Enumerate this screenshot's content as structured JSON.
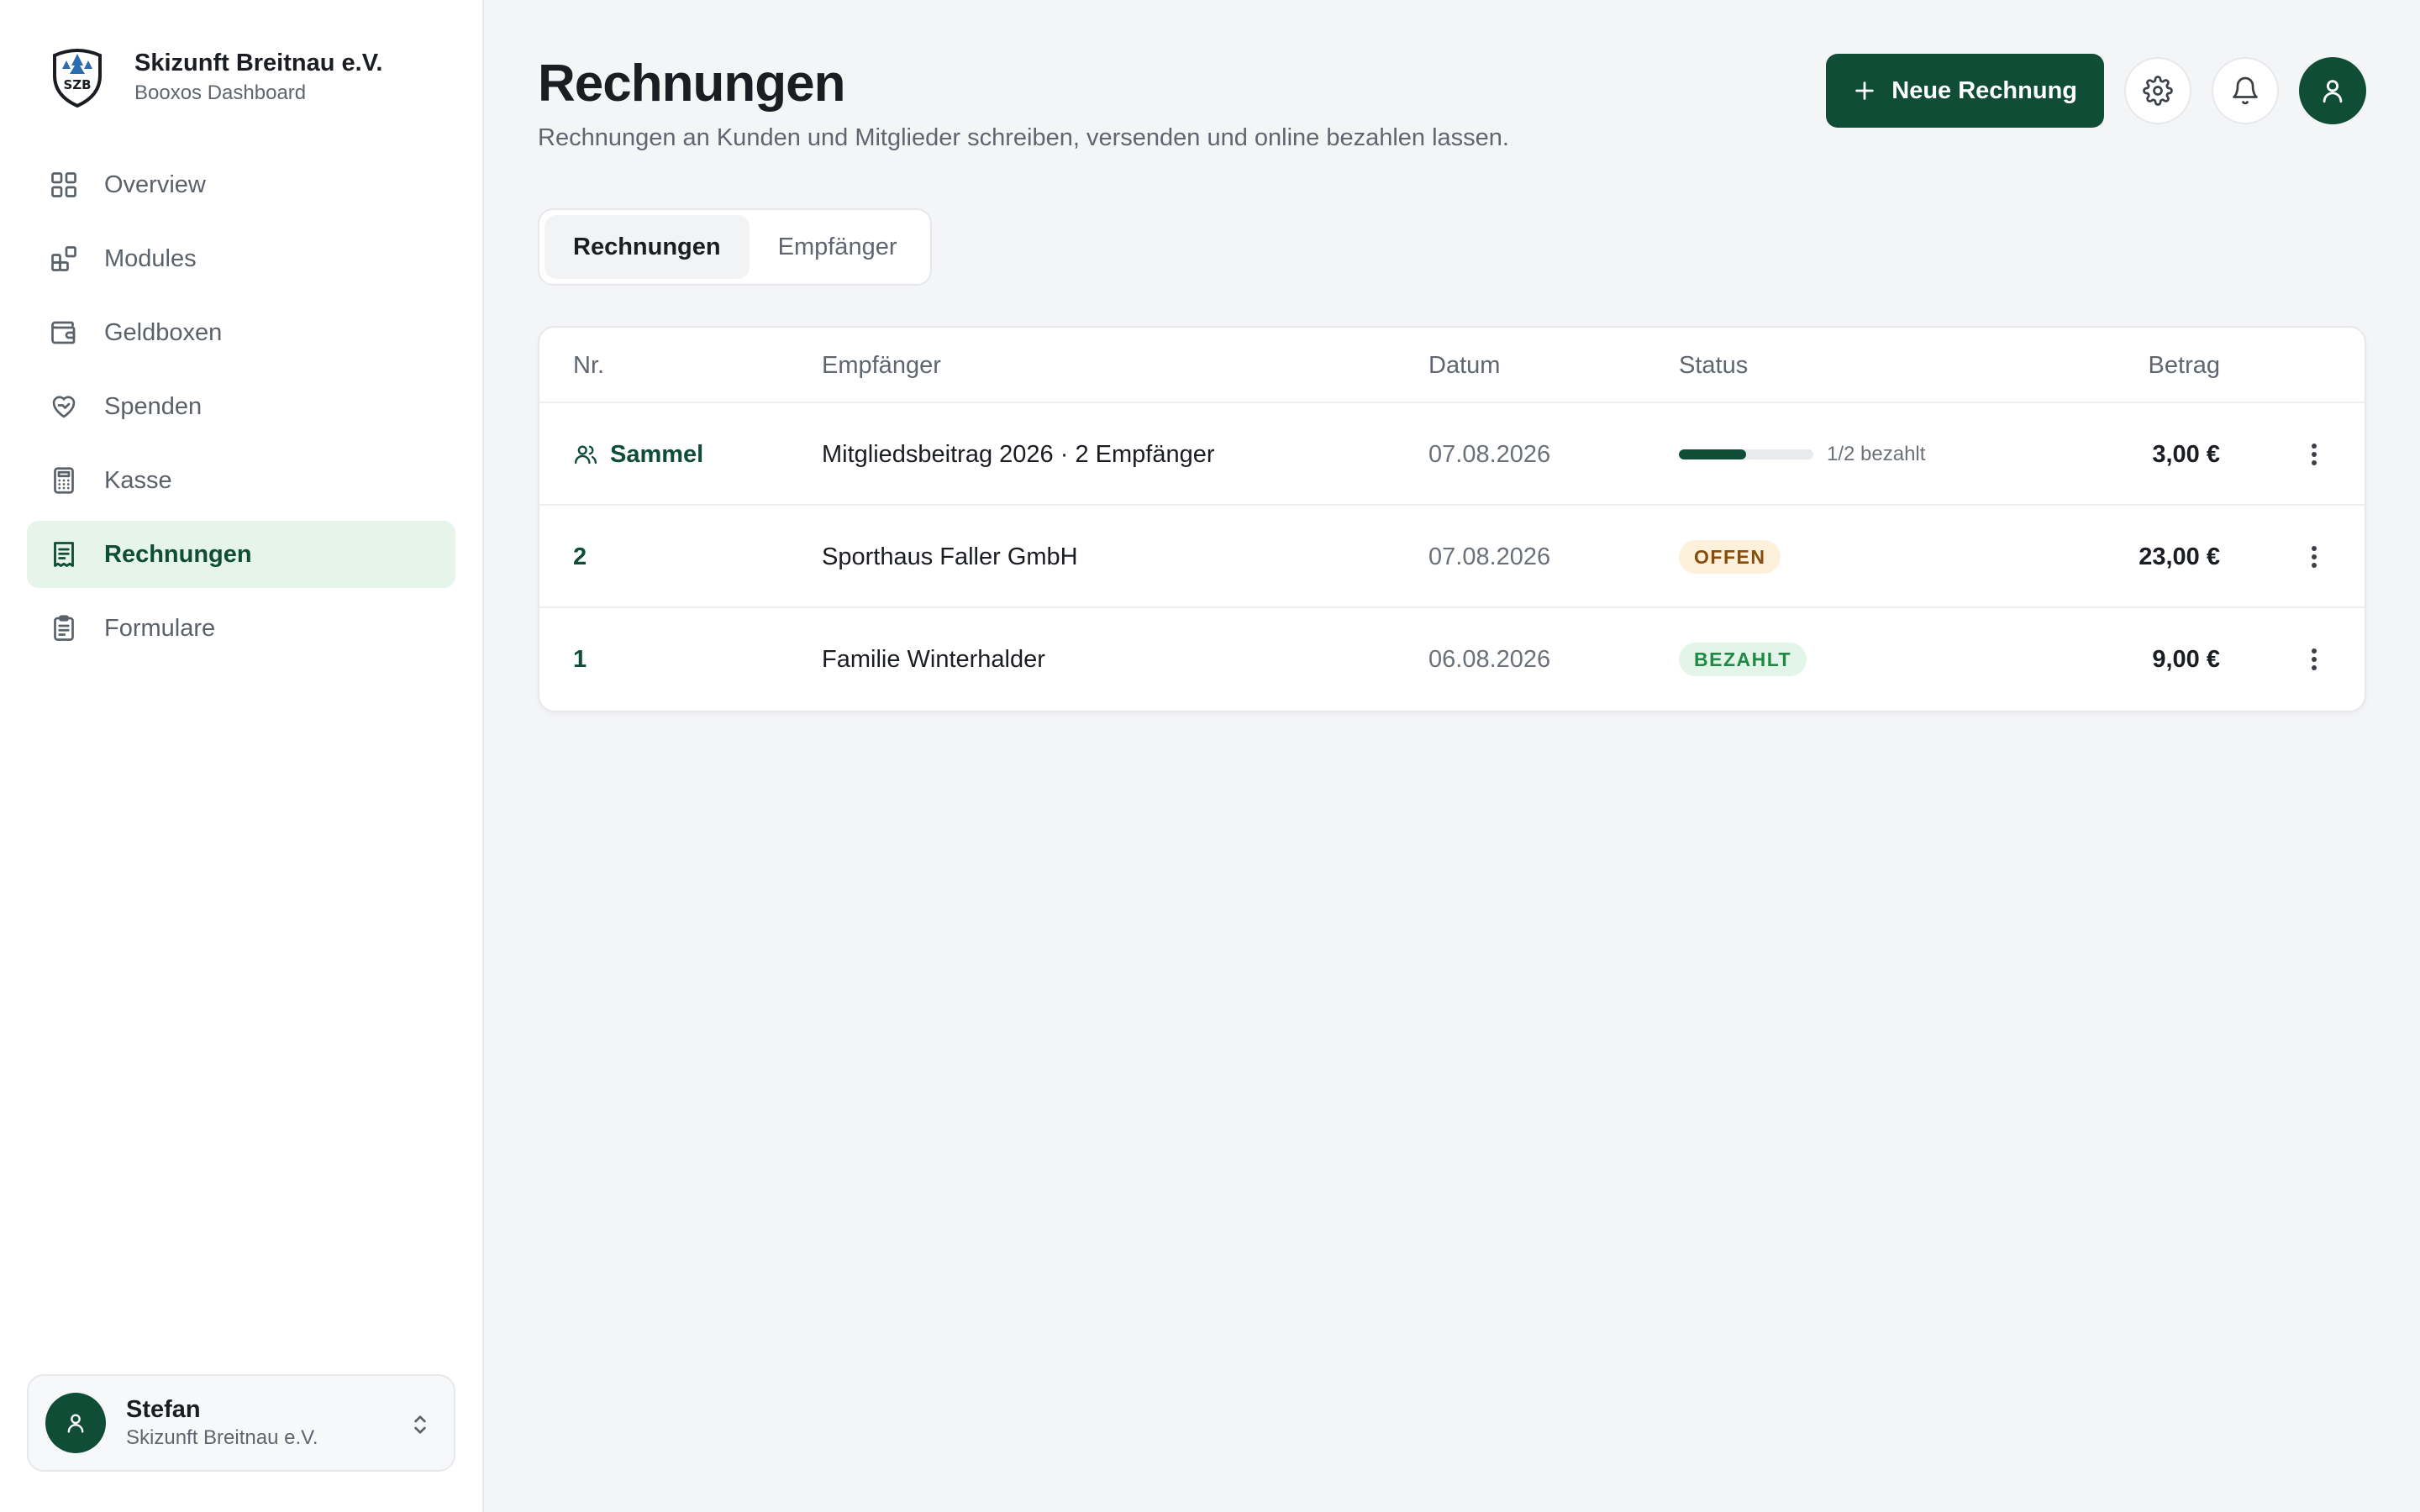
{
  "brand": {
    "name": "Skizunft Breitnau e.V.",
    "subtitle": "Booxos Dashboard",
    "logo_text": "SZB"
  },
  "sidebar": {
    "items": [
      {
        "label": "Overview",
        "icon": "grid-icon",
        "active": false
      },
      {
        "label": "Modules",
        "icon": "modules-icon",
        "active": false
      },
      {
        "label": "Geldboxen",
        "icon": "wallet-icon",
        "active": false
      },
      {
        "label": "Spenden",
        "icon": "heart-hand-icon",
        "active": false
      },
      {
        "label": "Kasse",
        "icon": "calculator-icon",
        "active": false
      },
      {
        "label": "Rechnungen",
        "icon": "receipt-icon",
        "active": true
      },
      {
        "label": "Formulare",
        "icon": "clipboard-icon",
        "active": false
      }
    ]
  },
  "user": {
    "name": "Stefan",
    "org": "Skizunft Breitnau e.V."
  },
  "header": {
    "title": "Rechnungen",
    "subtitle": "Rechnungen an Kunden und Mitglieder schreiben, versenden und online bezahlen lassen.",
    "new_button": "Neue Rechnung"
  },
  "tabs": [
    {
      "label": "Rechnungen",
      "active": true
    },
    {
      "label": "Empfänger",
      "active": false
    }
  ],
  "table": {
    "columns": {
      "nr": "Nr.",
      "recipient": "Empfänger",
      "date": "Datum",
      "status": "Status",
      "amount": "Betrag"
    },
    "rows": [
      {
        "nr": "Sammel",
        "recipient": "Mitgliedsbeitrag 2026 · 2 Empfänger",
        "date": "07.08.2026",
        "status_type": "progress",
        "progress": 0.5,
        "progress_label": "1/2 bezahlt",
        "amount": "3,00 €"
      },
      {
        "nr": "2",
        "recipient": "Sporthaus Faller GmbH",
        "date": "07.08.2026",
        "status_type": "badge",
        "status": "OFFEN",
        "amount": "23,00 €"
      },
      {
        "nr": "1",
        "recipient": "Familie Winterhalder",
        "date": "06.08.2026",
        "status_type": "badge",
        "status": "BEZAHLT",
        "amount": "9,00 €"
      }
    ]
  },
  "colors": {
    "accent": "#0f4d36",
    "active_nav_bg": "#e6f4ea",
    "badge_open_bg": "#fdf1dc",
    "badge_open_text": "#8a4b0b",
    "badge_paid_bg": "#e3f5e8",
    "badge_paid_text": "#1e8a45"
  }
}
